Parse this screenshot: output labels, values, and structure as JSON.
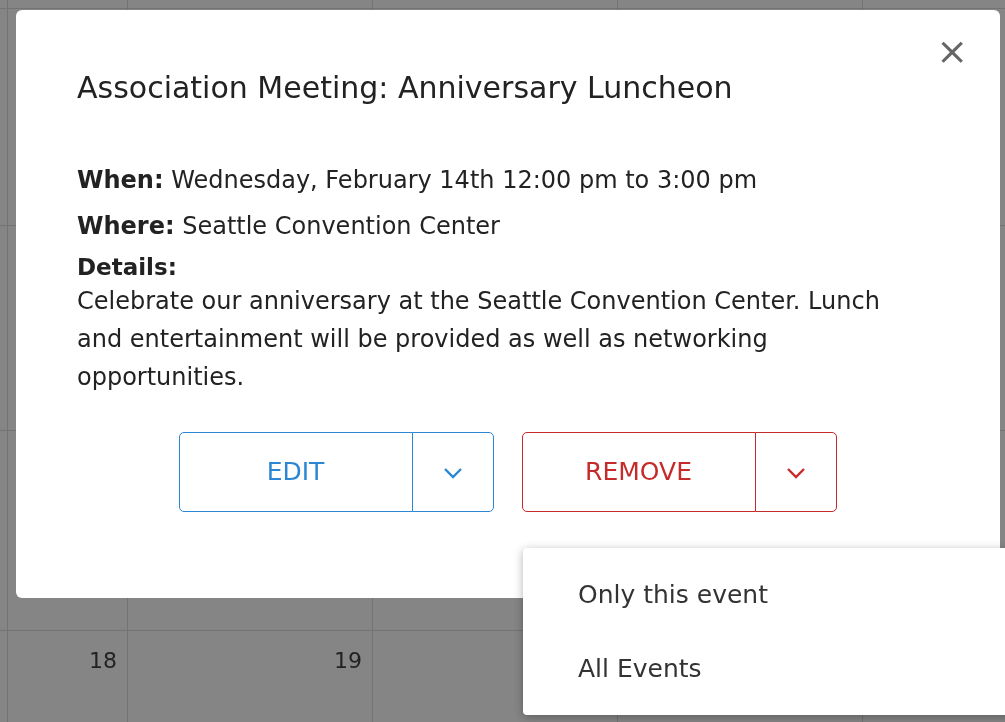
{
  "calendar": {
    "days": [
      {
        "number": "18"
      },
      {
        "number": "19"
      }
    ]
  },
  "modal": {
    "close": "×",
    "title": "Association Meeting: Anniversary Luncheon",
    "fields": [
      {
        "label": "When:",
        "value": "Wednesday, February 14th 12:00 pm to 3:00 pm"
      },
      {
        "label": "Where:",
        "value": "Seattle Convention Center"
      }
    ],
    "details": {
      "label": "Details:",
      "text": "Celebrate our anniversary at the Seattle Convention Center. Lunch and entertainment will be provided as well as networking opportunities."
    },
    "buttons": [
      {
        "label": "EDIT",
        "kind": "primary"
      },
      {
        "label": "REMOVE",
        "kind": "danger"
      }
    ],
    "menu": {
      "items": [
        {
          "label": "Only this event"
        },
        {
          "label": "All Events"
        }
      ]
    }
  }
}
